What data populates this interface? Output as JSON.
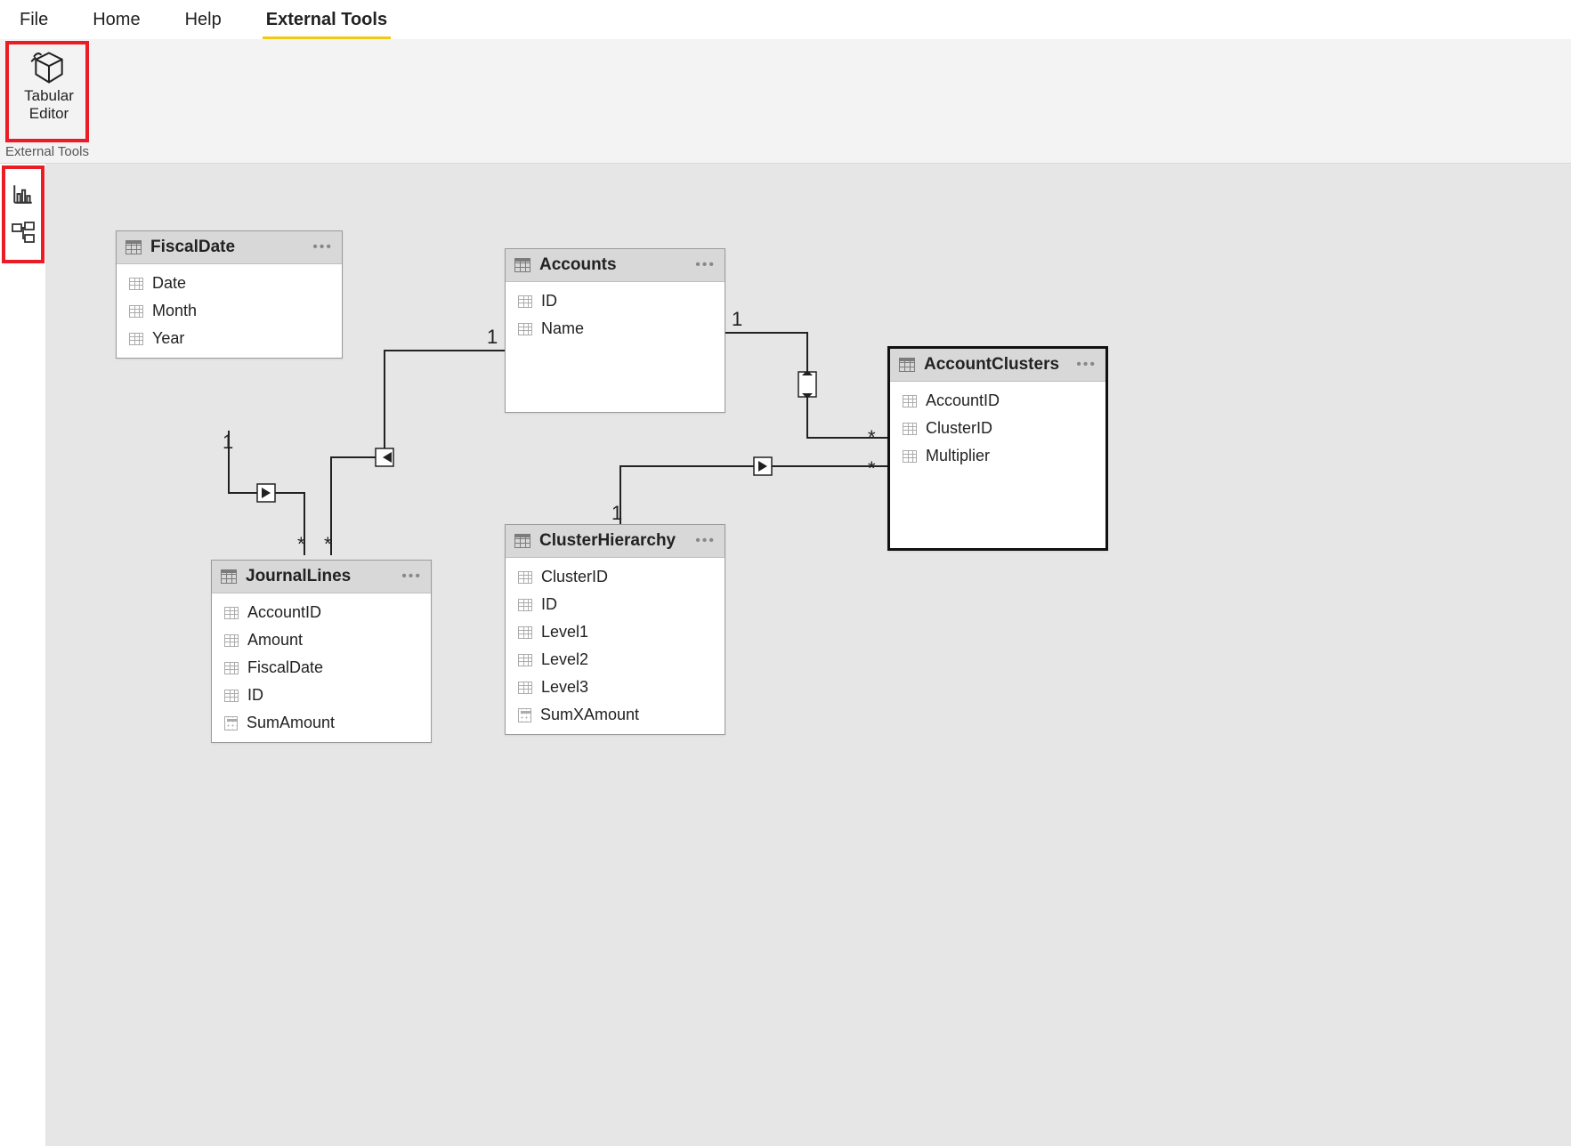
{
  "menu": {
    "file": "File",
    "home": "Home",
    "help": "Help",
    "external_tools": "External Tools"
  },
  "ribbon": {
    "tabular_editor": {
      "line1": "Tabular",
      "line2": "Editor"
    },
    "group_label": "External Tools"
  },
  "tables": {
    "fiscaldate": {
      "name": "FiscalDate",
      "cols": [
        "Date",
        "Month",
        "Year"
      ]
    },
    "accounts": {
      "name": "Accounts",
      "cols": [
        "ID",
        "Name"
      ]
    },
    "journallines": {
      "name": "JournalLines",
      "cols": [
        {
          "label": "AccountID",
          "type": "col"
        },
        {
          "label": "Amount",
          "type": "col"
        },
        {
          "label": "FiscalDate",
          "type": "col"
        },
        {
          "label": "ID",
          "type": "col"
        },
        {
          "label": "SumAmount",
          "type": "calc"
        }
      ]
    },
    "clusterhierarchy": {
      "name": "ClusterHierarchy",
      "cols": [
        {
          "label": "ClusterID",
          "type": "col"
        },
        {
          "label": "ID",
          "type": "col"
        },
        {
          "label": "Level1",
          "type": "col"
        },
        {
          "label": "Level2",
          "type": "col"
        },
        {
          "label": "Level3",
          "type": "col"
        },
        {
          "label": "SumXAmount",
          "type": "calc"
        }
      ]
    },
    "accountclusters": {
      "name": "AccountClusters",
      "cols": [
        "AccountID",
        "ClusterID",
        "Multiplier"
      ]
    }
  },
  "rel_labels": {
    "one": "1",
    "many": "*"
  }
}
